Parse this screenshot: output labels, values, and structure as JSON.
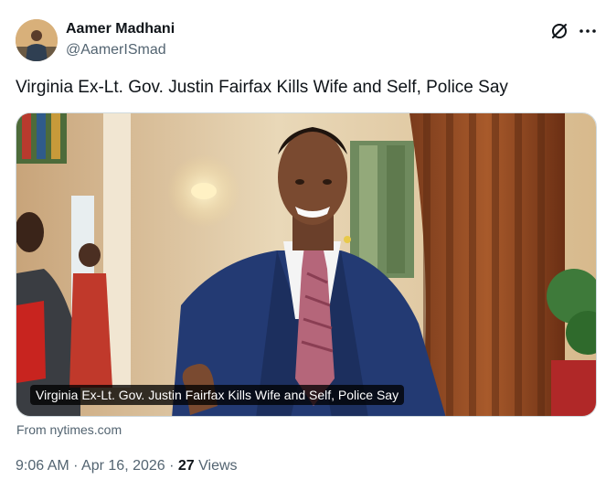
{
  "author": {
    "name": "Aamer Madhani",
    "handle": "@AamerISmad"
  },
  "icons": {
    "grok": "grok-slash-circle-icon",
    "more": "more-horizontal-icon"
  },
  "tweet": {
    "text": "Virginia Ex-Lt. Gov. Justin Fairfax Kills Wife and Self, Police Say"
  },
  "card": {
    "caption": "Virginia Ex-Lt. Gov. Justin Fairfax Kills Wife and Self, Police Say",
    "source": "From nytimes.com"
  },
  "meta": {
    "time": "9:06 AM",
    "separator": "·",
    "date": "Apr 16, 2026",
    "views_count": "27",
    "views_label": "Views"
  },
  "colors": {
    "text_primary": "#0f1419",
    "text_secondary": "#536471",
    "border": "#cfd9de",
    "suit_blue": "#233a73",
    "tie_pink": "#b5667a"
  }
}
